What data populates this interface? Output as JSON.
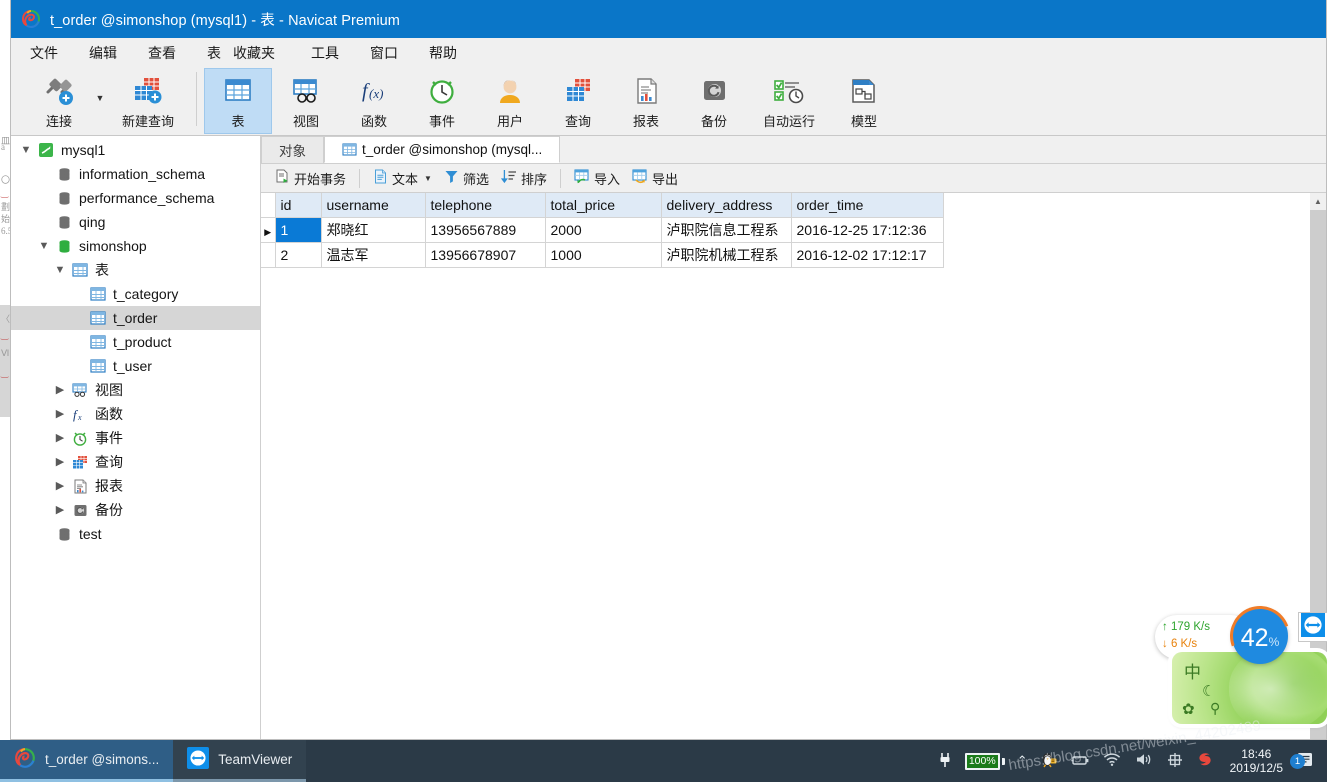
{
  "window": {
    "title": "t_order @simonshop (mysql1) - 表 - Navicat Premium",
    "logo_icon": "navicat-logo-icon"
  },
  "menubar": {
    "items": [
      {
        "label": "文件",
        "name": "menu-file"
      },
      {
        "label": "编辑",
        "name": "menu-edit"
      },
      {
        "label": "查看",
        "name": "menu-view"
      },
      {
        "label": "表",
        "name": "menu-table"
      },
      {
        "label": "收藏夹",
        "name": "menu-favorites"
      },
      {
        "label": "工具",
        "name": "menu-tools"
      },
      {
        "label": "窗口",
        "name": "menu-window"
      },
      {
        "label": "帮助",
        "name": "menu-help"
      }
    ]
  },
  "toolbar": {
    "items": [
      {
        "label": "连接",
        "icon": "connection-plug-icon"
      },
      {
        "label": "新建查询",
        "icon": "new-query-icon"
      },
      {
        "label": "表",
        "icon": "table-icon",
        "active": true
      },
      {
        "label": "视图",
        "icon": "view-icon"
      },
      {
        "label": "函数",
        "icon": "function-fx-icon"
      },
      {
        "label": "事件",
        "icon": "event-clock-icon"
      },
      {
        "label": "用户",
        "icon": "user-icon"
      },
      {
        "label": "查询",
        "icon": "query-icon"
      },
      {
        "label": "报表",
        "icon": "report-icon"
      },
      {
        "label": "备份",
        "icon": "backup-icon"
      },
      {
        "label": "自动运行",
        "icon": "automation-icon"
      },
      {
        "label": "模型",
        "icon": "model-icon"
      }
    ]
  },
  "sidebar": {
    "items": [
      {
        "label": "mysql1",
        "indent": 1,
        "arrow": "▼",
        "icon": "mysql-connection-icon",
        "selected": false
      },
      {
        "label": "information_schema",
        "indent": 2,
        "arrow": "",
        "icon": "database-icon",
        "selected": false
      },
      {
        "label": "performance_schema",
        "indent": 2,
        "arrow": "",
        "icon": "database-icon",
        "selected": false
      },
      {
        "label": "qing",
        "indent": 2,
        "arrow": "",
        "icon": "database-icon",
        "selected": false
      },
      {
        "label": "simonshop",
        "indent": 2,
        "arrow": "▼",
        "icon": "database-open-icon",
        "selected": false
      },
      {
        "label": "表",
        "indent": 3,
        "arrow": "▼",
        "icon": "table-icon",
        "selected": false
      },
      {
        "label": "t_category",
        "indent": 4,
        "arrow": "",
        "icon": "table-icon",
        "selected": false
      },
      {
        "label": "t_order",
        "indent": 4,
        "arrow": "",
        "icon": "table-icon",
        "selected": true
      },
      {
        "label": "t_product",
        "indent": 4,
        "arrow": "",
        "icon": "table-icon",
        "selected": false
      },
      {
        "label": "t_user",
        "indent": 4,
        "arrow": "",
        "icon": "table-icon",
        "selected": false
      },
      {
        "label": "视图",
        "indent": 3,
        "arrow": "▶",
        "icon": "view-icon",
        "selected": false
      },
      {
        "label": "函数",
        "indent": 3,
        "arrow": "▶",
        "icon": "function-fx-icon",
        "selected": false
      },
      {
        "label": "事件",
        "indent": 3,
        "arrow": "▶",
        "icon": "event-clock-icon",
        "selected": false
      },
      {
        "label": "查询",
        "indent": 3,
        "arrow": "▶",
        "icon": "query-icon",
        "selected": false
      },
      {
        "label": "报表",
        "indent": 3,
        "arrow": "▶",
        "icon": "report-icon",
        "selected": false
      },
      {
        "label": "备份",
        "indent": 3,
        "arrow": "▶",
        "icon": "backup-icon",
        "selected": false
      },
      {
        "label": "test",
        "indent": 2,
        "arrow": "",
        "icon": "database-icon",
        "selected": false
      }
    ]
  },
  "tabs": [
    {
      "label": "对象",
      "icon": "",
      "active": false,
      "name": "tab-objects"
    },
    {
      "label": "t_order @simonshop (mysql...",
      "icon": "table-icon",
      "active": true,
      "name": "tab-t-order"
    }
  ],
  "grid_toolbar": {
    "items": [
      {
        "label": "开始事务",
        "icon": "begin-transaction-icon",
        "caret": false
      },
      {
        "label": "文本",
        "icon": "text-icon",
        "caret": true
      },
      {
        "label": "筛选",
        "icon": "filter-icon",
        "caret": false
      },
      {
        "label": "排序",
        "icon": "sort-icon",
        "caret": false
      },
      {
        "label": "导入",
        "icon": "import-icon",
        "caret": false
      },
      {
        "label": "导出",
        "icon": "export-icon",
        "caret": false
      }
    ]
  },
  "grid": {
    "columns": [
      "id",
      "username",
      "telephone",
      "total_price",
      "delivery_address",
      "order_time"
    ],
    "rows": [
      {
        "selected": true,
        "marker": "▶",
        "cells": [
          "1",
          "郑晓红",
          "13956567889",
          "2000",
          "泸职院信息工程系",
          "2016-12-25 17:12:36"
        ]
      },
      {
        "selected": false,
        "marker": "",
        "cells": [
          "2",
          "温志军",
          "13956678907",
          "1000",
          "泸职院机械工程系",
          "2016-12-02 17:12:17"
        ]
      }
    ]
  },
  "overlays": {
    "netmon": {
      "up": "↑ 179 K/s",
      "down": "↓ 6   K/s"
    },
    "cpu": {
      "value": "42",
      "unit": "%"
    },
    "ime": {
      "mode": "中",
      "moon": "☾",
      "gear": "✿",
      "pin": "⚲"
    },
    "teamviewer_float_icon": "teamviewer-icon"
  },
  "taskbar": {
    "items": [
      {
        "label": "t_order @simons...",
        "icon": "navicat-logo-icon",
        "name": "taskbar-navicat"
      },
      {
        "label": "TeamViewer",
        "icon": "teamviewer-icon",
        "name": "taskbar-teamviewer"
      }
    ],
    "tray": {
      "battery_percent": "100%",
      "chevron": "⌃",
      "icons": [
        "qq-penguin-icon",
        "battery-icon",
        "wifi-icon",
        "volume-icon",
        "input-method-icon",
        "sogou-icon"
      ],
      "time": "18:46",
      "date": "2019/12/5",
      "notification_count": "1"
    }
  },
  "watermark": {
    "text": "https://blog.csdn.net/weixin_44202489"
  }
}
